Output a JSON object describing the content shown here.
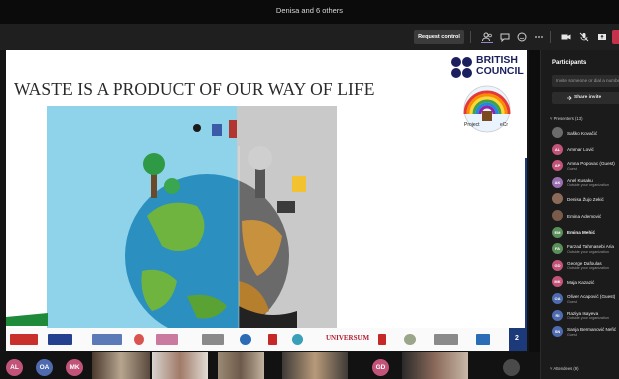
{
  "window": {
    "title": "Denisa and 6 others"
  },
  "toolbar": {
    "request_control_label": "Request control",
    "icons": [
      "people-icon",
      "chat-icon",
      "reaction-icon",
      "more-icon",
      "camera-icon",
      "mic-off-icon",
      "share-icon",
      "leave-icon"
    ],
    "accent_color": "#8b8cc7",
    "leave_color": "#c4314b"
  },
  "slide": {
    "title": "WASTE IS A PRODUCT OF OUR WAY OF LIFE",
    "brand_line1": "BRITISH",
    "brand_line2": "COUNCIL",
    "badge_left": "Project",
    "badge_right": "eCr",
    "university_logo_text": "UNIVERSUM",
    "slide_number": "2",
    "brand_color": "#1b1f5e",
    "strip_color": "#1c3a7a"
  },
  "participants_panel": {
    "title": "Participants",
    "invite_placeholder": "Invite someone or dial a number",
    "share_invite_label": "Share invite",
    "presenters_header": "Presenters (13)",
    "attendees_header": "Attendees (9)",
    "presenters": [
      {
        "name": "Saško Kovačić",
        "initials": "",
        "color": "#6b6b6b",
        "sub": ""
      },
      {
        "name": "Ammar Lović",
        "initials": "AL",
        "color": "#c2547a",
        "sub": ""
      },
      {
        "name": "Amna Popovac (Guest)",
        "initials": "AP",
        "color": "#c2547a",
        "sub": "Guest"
      },
      {
        "name": "Anel Kusaku",
        "initials": "AK",
        "color": "#9a6fb0",
        "sub": "Outside your organization"
      },
      {
        "name": "Denisa Žujo Zekić",
        "initials": "",
        "color": "#8c6a5a",
        "sub": ""
      },
      {
        "name": "Emina Ademović",
        "initials": "",
        "color": "#7a5a4a",
        "sub": ""
      },
      {
        "name": "Emina Mehić",
        "initials": "EM",
        "color": "#5a8f5a",
        "sub": ""
      },
      {
        "name": "Farzad Tahmasebi Aria",
        "initials": "FA",
        "color": "#5a8f5a",
        "sub": "Outside your organization"
      },
      {
        "name": "George Dafoulas",
        "initials": "GD",
        "color": "#c2547a",
        "sub": "Outside your organization"
      },
      {
        "name": "Maja Kazazić",
        "initials": "MK",
        "color": "#c2547a",
        "sub": ""
      },
      {
        "name": "Oliver Acapović (Guest)",
        "initials": "OA",
        "color": "#4f6bb0",
        "sub": "Guest"
      },
      {
        "name": "Raziya Isayeva",
        "initials": "RI",
        "color": "#4f6bb0",
        "sub": "Outside your organization"
      },
      {
        "name": "Sanja Bermanović Nefić",
        "initials": "SN",
        "color": "#4f6bb0",
        "sub": "Guest"
      }
    ]
  },
  "bottom_strip": {
    "avatars": [
      {
        "initials": "AL",
        "color": "#c2547a"
      },
      {
        "initials": "OA",
        "color": "#4f6bb0"
      },
      {
        "initials": "MK",
        "color": "#c2547a"
      },
      {
        "initials": "GD",
        "color": "#c2547a"
      }
    ]
  }
}
